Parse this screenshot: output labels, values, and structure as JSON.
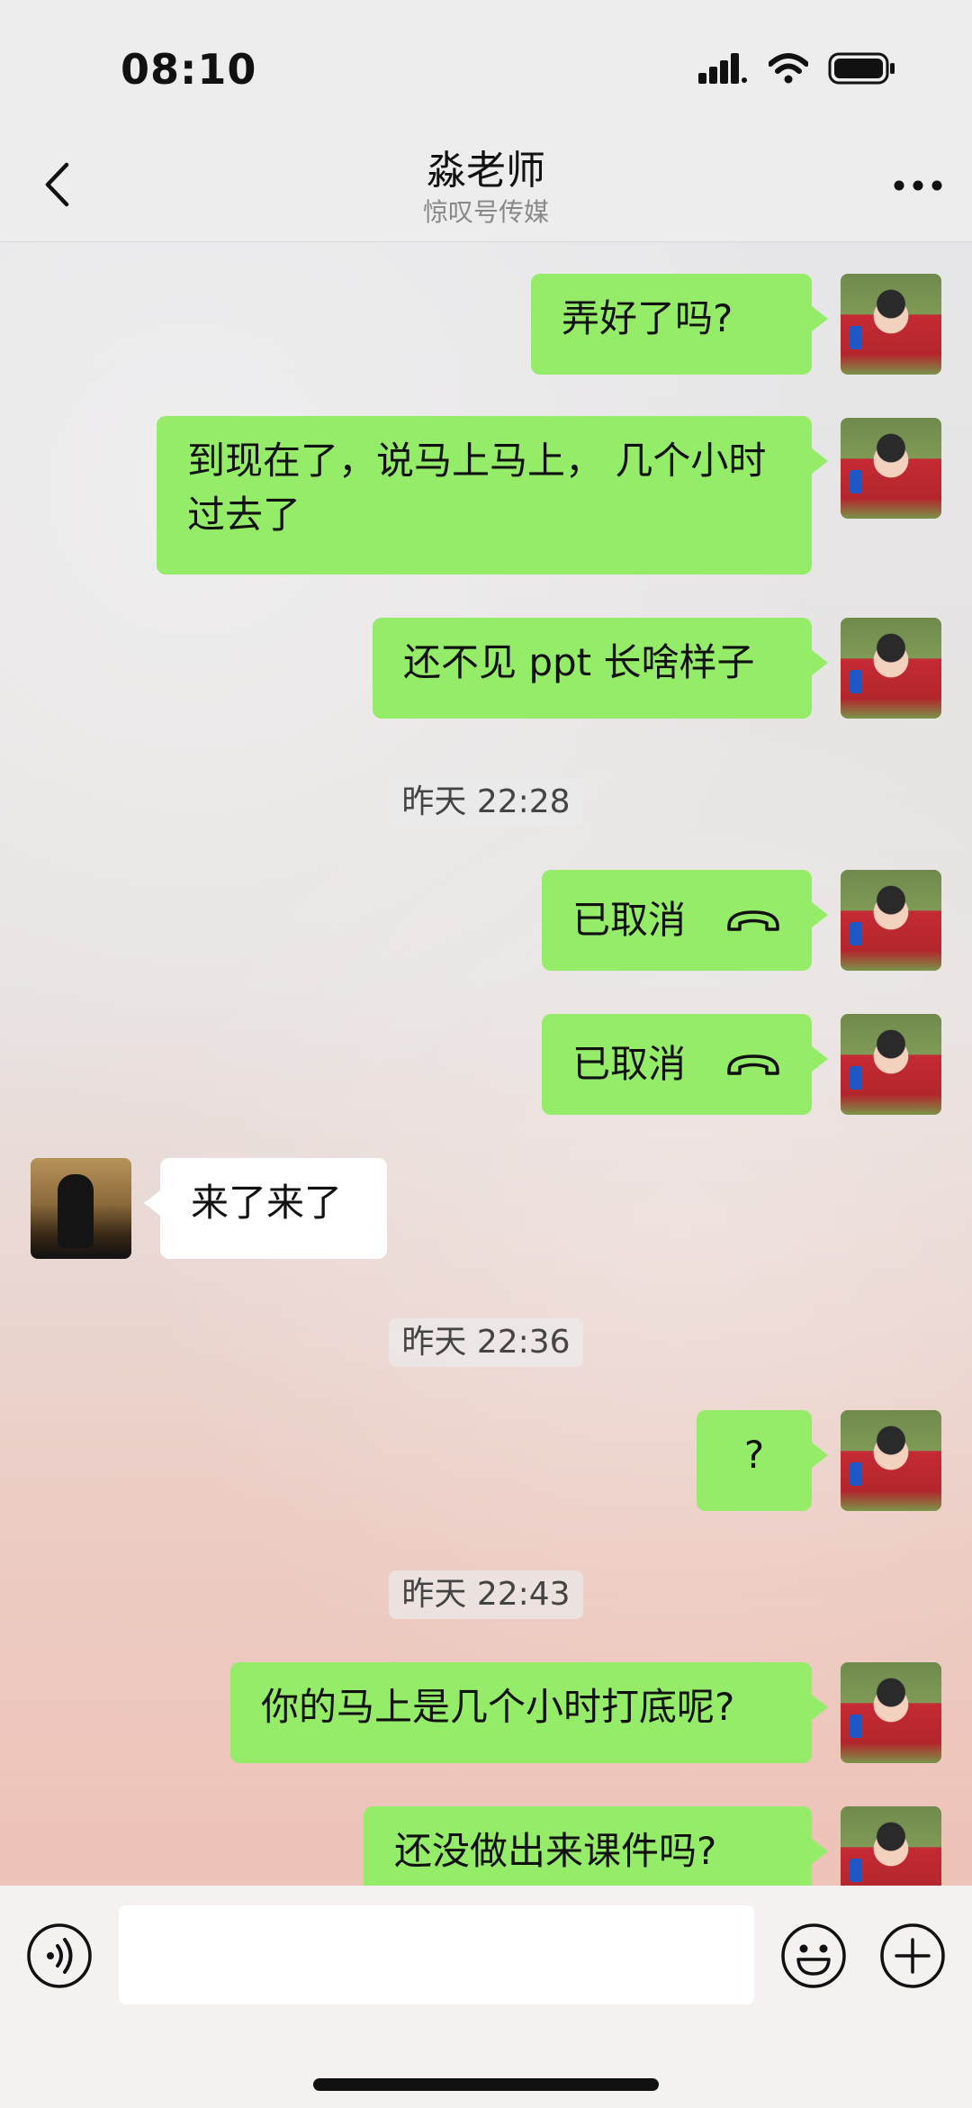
{
  "status_bar": {
    "time": "08:10",
    "icons": [
      "signal-icon",
      "wifi-icon",
      "battery-icon"
    ]
  },
  "header": {
    "back_icon": "chevron-left-icon",
    "title": "淼老师",
    "subtitle": "惊叹号传媒",
    "more_icon": "more-icon"
  },
  "messages": [
    {
      "side": "me",
      "text": "弄好了吗?"
    },
    {
      "side": "me",
      "text": "到现在了，说马上马上， 几个小时过去了"
    },
    {
      "side": "me",
      "text": "还不见 ppt 长啥样子"
    },
    {
      "type": "time",
      "text": "昨天 22:28"
    },
    {
      "side": "me",
      "type": "call",
      "text": "已取消",
      "icon": "phone-hangup-icon"
    },
    {
      "side": "me",
      "type": "call",
      "text": "已取消",
      "icon": "phone-hangup-icon"
    },
    {
      "side": "other",
      "text": "来了来了"
    },
    {
      "type": "time",
      "text": "昨天 22:36"
    },
    {
      "side": "me",
      "text": "?"
    },
    {
      "type": "time",
      "text": "昨天 22:43"
    },
    {
      "side": "me",
      "text": "你的马上是几个小时打底呢?"
    },
    {
      "side": "me",
      "text": "还没做出来课件吗?"
    }
  ],
  "input_bar": {
    "voice_icon": "voice-icon",
    "input_value": "",
    "emoji_icon": "emoji-icon",
    "plus_icon": "plus-icon"
  },
  "colors": {
    "bubble_me": "#95ec69",
    "bubble_other": "#ffffff",
    "header_bg": "#ededed"
  }
}
